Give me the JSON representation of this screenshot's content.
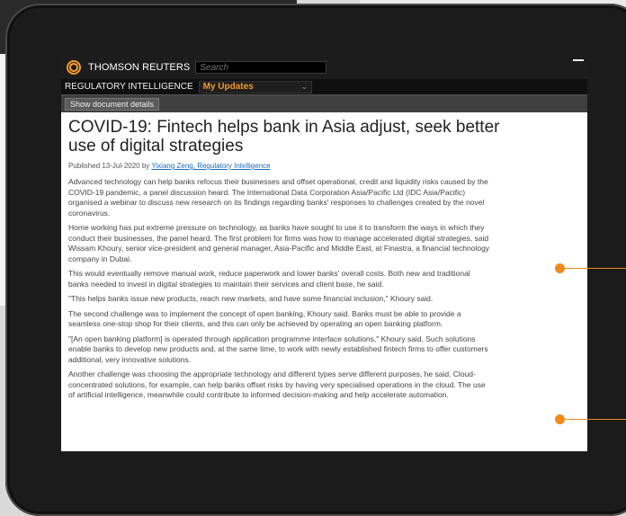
{
  "header": {
    "brand": "THOMSON REUTERS",
    "search_placeholder": "Search"
  },
  "subheader": {
    "label": "REGULATORY INTELLIGENCE",
    "dropdown_value": "My Updates"
  },
  "toolbar": {
    "show_details_label": "Show document details"
  },
  "article": {
    "title": "COVID-19: Fintech helps bank in Asia adjust, seek better use of digital strategies",
    "published_prefix": "Published 13-Jul-2020 by ",
    "author": "Yixiang Zeng, Regulatory Intelligence",
    "paragraphs": [
      "Advanced technology can help banks refocus their businesses and offset operational, credit and liquidity risks caused by the COVID-19 pandemic, a panel discussion heard. The International Data Corporation Asia/Pacific Ltd (IDC Asia/Pacific) organised a webinar to discuss new research on its findings regarding banks' responses to challenges created by the novel coronavirus.",
      "Home working has put extreme pressure on technology, as banks have sought to use it to transform the ways in which they conduct their businesses, the panel heard. The first problem for firms was how to manage accelerated digital strategies, said Wissam Khoury, senior vice-president and general manager, Asia-Pacific and Middle East, at Finastra, a financial technology company in Dubai.",
      "This would eventually remove manual work, reduce paperwork and lower banks' overall costs. Both new and traditional banks needed to invest in digital strategies to maintain their services and client base, he said.",
      "\"This helps banks issue new products, reach new markets, and have some financial inclusion,\" Khoury said.",
      "The second challenge was to implement the concept of open banking, Khoury said. Banks must be able to provide a seamless one-stop shop for their clients, and this can only be achieved by operating an open banking platform.",
      "\"[An open banking platform] is operated through application programme interface solutions,\" Khoury said. Such solutions enable banks to develop new products and, at the same time, to work with newly established fintech firms to offer customers additional, very innovative solutions.",
      "Another challenge was choosing the appropriate technology and different types serve different purposes, he said. Cloud-concentrated solutions, for example, can help banks offset risks by having very specialised operations in the cloud. The use of artificial intelligence, meanwhile could contribute to informed decision-making and help accelerate automation."
    ]
  },
  "colors": {
    "accent_orange": "#f29a2e",
    "callout_orange": "#f08a1c",
    "link_blue": "#1a6bbf"
  }
}
